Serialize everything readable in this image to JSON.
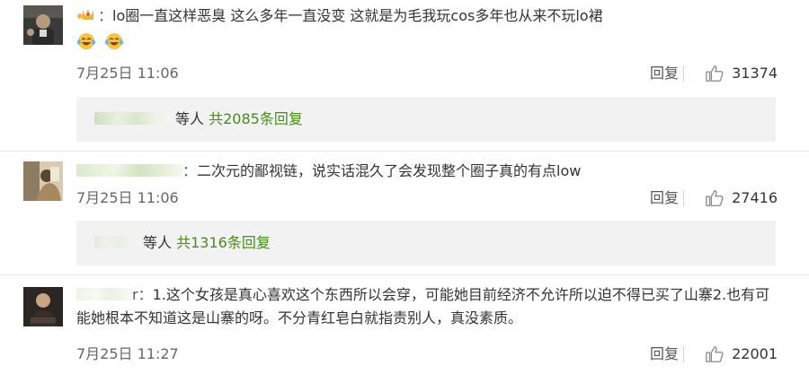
{
  "comments": [
    {
      "user_name_suffix": "",
      "text": "lo圈一直这样恶臭 这么多年一直没变 这就是为毛我玩cos多年也从来不玩lo裙",
      "time": "7月25日 11:06",
      "reply_label": "回复",
      "likes": "31374",
      "replies": {
        "prefix": "等人",
        "count_text": "共2085条回复"
      }
    },
    {
      "user_name_suffix": "",
      "text": "二次元的鄙视链，说实话混久了会发现整个圈子真的有点low",
      "time": "7月25日 11:06",
      "reply_label": "回复",
      "likes": "27416",
      "replies": {
        "prefix": "等人",
        "count_text": "共1316条回复"
      }
    },
    {
      "user_name_suffix": "r",
      "text": "1.这个女孩是真心喜欢这个东西所以会穿，可能她目前经济不允许所以迫不得已买了山寨2.也有可能她根本不知道这是山寨的呀。不分青红皂白就指责别人，真没素质。",
      "time": "7月25日 11:27",
      "reply_label": "回复",
      "likes": "22001"
    }
  ],
  "icons": {
    "like": "thumbs-up-icon",
    "crown_badge": "crown-emoji-icon",
    "laugh_emoji": "laughing-tears-emoji-icon"
  },
  "colors": {
    "link_green": "#4a8a1e",
    "reply_box_bg": "#f2f2f2",
    "text": "#333333",
    "meta": "#666666"
  }
}
